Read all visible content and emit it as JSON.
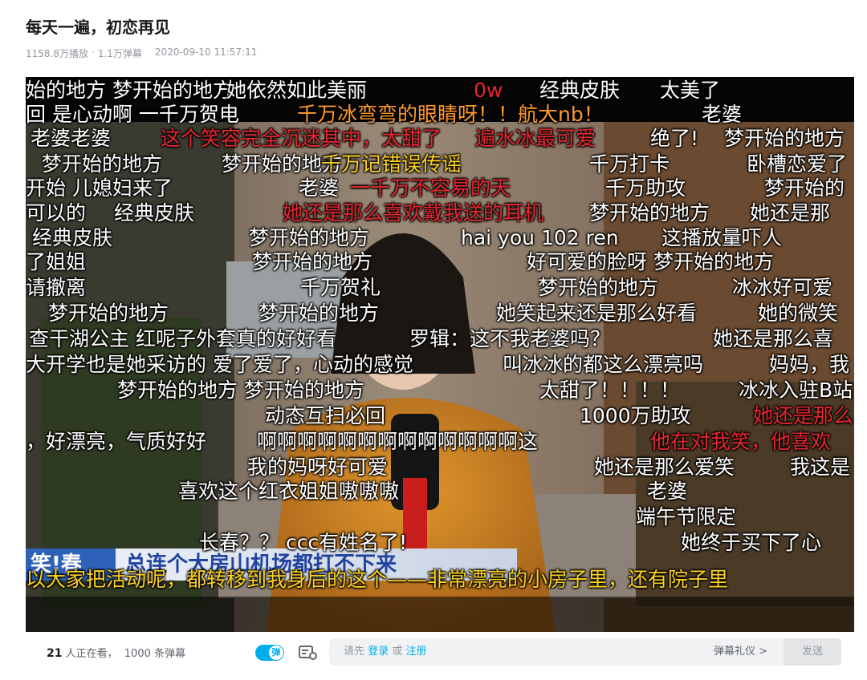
{
  "video": {
    "title": "每天一遍，初恋再见",
    "views": "1158.8万播放",
    "separator": "·",
    "danmaku_count": "1.1万弹幕",
    "publish_time": "2020-09-10 11:57:11"
  },
  "player": {
    "lower_third_left": "笑!春",
    "lower_third_right": "总连个大房山机场都打不下来",
    "danmaku": [
      {
        "text": "始的地方 梦开始的地方",
        "color": "white"
      },
      {
        "text": "她依然如此美丽",
        "color": "white"
      },
      {
        "text": "0w",
        "color": "red"
      },
      {
        "text": "经典皮肤",
        "color": "white"
      },
      {
        "text": "太美了",
        "color": "white"
      },
      {
        "text": "回 是心动啊 一千万贺电",
        "color": "white"
      },
      {
        "text": "千万冰弯弯的眼睛呀！！航大nb！",
        "color": "orange"
      },
      {
        "text": "老婆",
        "color": "white"
      },
      {
        "text": "老婆老婆",
        "color": "white"
      },
      {
        "text": "这个笑容完全沉迷其中，太甜了",
        "color": "red"
      },
      {
        "text": "遍水冰最可爱",
        "color": "red"
      },
      {
        "text": "绝了!",
        "color": "white"
      },
      {
        "text": "梦开始的地方",
        "color": "white"
      },
      {
        "text": "梦开始的地方",
        "color": "white"
      },
      {
        "text": "梦开始的地方",
        "color": "white"
      },
      {
        "text": "千万记错误传谣",
        "color": "yellow"
      },
      {
        "text": "千万打卡",
        "color": "white"
      },
      {
        "text": "卧槽恋爱了",
        "color": "white"
      },
      {
        "text": "开始 儿媳妇来了",
        "color": "white"
      },
      {
        "text": "老婆",
        "color": "white"
      },
      {
        "text": "一千万不容易的天",
        "color": "red"
      },
      {
        "text": "千万助攻",
        "color": "white"
      },
      {
        "text": "梦开始的",
        "color": "white"
      },
      {
        "text": "可以的",
        "color": "white"
      },
      {
        "text": "经典皮肤",
        "color": "white"
      },
      {
        "text": "她还是那么喜欢戴我送的耳机",
        "color": "red"
      },
      {
        "text": "梦开始的地方",
        "color": "white"
      },
      {
        "text": "她还是那",
        "color": "white"
      },
      {
        "text": "经典皮肤",
        "color": "white"
      },
      {
        "text": "梦开始的地方",
        "color": "white"
      },
      {
        "text": "hai you 102 ren",
        "color": "white"
      },
      {
        "text": "这播放量吓人",
        "color": "white"
      },
      {
        "text": "了姐姐",
        "color": "white"
      },
      {
        "text": "梦开始的地方",
        "color": "white"
      },
      {
        "text": "好可爱的脸呀 梦开始的地方",
        "color": "white"
      },
      {
        "text": "请撤离",
        "color": "white"
      },
      {
        "text": "千万贺礼",
        "color": "white"
      },
      {
        "text": "梦开始的地方",
        "color": "white"
      },
      {
        "text": "冰冰好可爱",
        "color": "white"
      },
      {
        "text": "梦开始的地方",
        "color": "white"
      },
      {
        "text": "梦开始的地方",
        "color": "white"
      },
      {
        "text": "她笑起来还是那么好看",
        "color": "white"
      },
      {
        "text": "她的微笑",
        "color": "white"
      },
      {
        "text": "查干湖公主 红呢子外套真的好好看",
        "color": "white"
      },
      {
        "text": "罗辑：这不我老婆吗？",
        "color": "white"
      },
      {
        "text": "她还是那么喜",
        "color": "white"
      },
      {
        "text": "大开学也是她采访的 爱了爱了，心动的感觉",
        "color": "white"
      },
      {
        "text": "叫冰冰的都这么漂亮吗",
        "color": "white"
      },
      {
        "text": "妈妈，我",
        "color": "white"
      },
      {
        "text": "梦开始的地方 梦开始的地方",
        "color": "white"
      },
      {
        "text": "太甜了！！！！",
        "color": "white"
      },
      {
        "text": "冰冰入驻B站",
        "color": "white"
      },
      {
        "text": "动态互扫必回",
        "color": "white"
      },
      {
        "text": "1000万助攻",
        "color": "white"
      },
      {
        "text": "她还是那么",
        "color": "red"
      },
      {
        "text": "，好漂亮，气质好好",
        "color": "white"
      },
      {
        "text": "啊啊啊啊啊啊啊啊啊啊啊啊啊这",
        "color": "white"
      },
      {
        "text": "他在对我笑，他喜欢",
        "color": "red"
      },
      {
        "text": "我的妈呀好可爱",
        "color": "white"
      },
      {
        "text": "她还是那么爱笑",
        "color": "white"
      },
      {
        "text": "我这是",
        "color": "white"
      },
      {
        "text": "喜欢这个红衣姐姐嗷嗷嗷",
        "color": "white"
      },
      {
        "text": "老婆",
        "color": "white"
      },
      {
        "text": "端午节限定",
        "color": "white"
      },
      {
        "text": "长春？？ ccc有姓名了!",
        "color": "white"
      },
      {
        "text": "她终于买下了心",
        "color": "white"
      },
      {
        "text": "以大家把活动呢，都转移到我身后的这个——非常漂亮的小房子里，还有院子里",
        "color": "yellow"
      }
    ]
  },
  "bar": {
    "viewer_count": "21",
    "viewer_text": "人正在看，",
    "danmaku_total": "1000 条弹幕",
    "toggle_label": "弹",
    "placeholder_prefix": "请先",
    "login_label": "登录",
    "or_label": "或",
    "register_label": "注册",
    "etiquette_label": "弹幕礼仪 >",
    "send_label": "发送"
  },
  "colors": {
    "accent": "#00aeec",
    "red_danmaku": "#e7272f",
    "yellow_danmaku": "#ffd21f"
  }
}
